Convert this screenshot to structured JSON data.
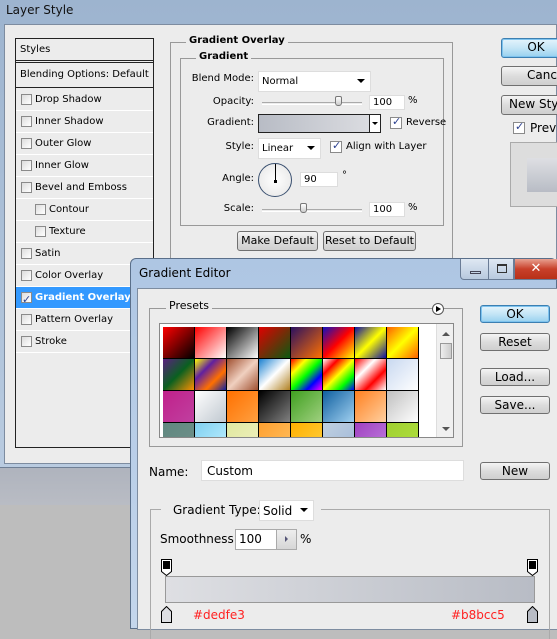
{
  "layer_style": {
    "title": "Layer Style",
    "styles_header": "Styles",
    "blending": "Blending Options: Default",
    "items": [
      {
        "label": "Drop Shadow",
        "checked": false,
        "sub": false
      },
      {
        "label": "Inner Shadow",
        "checked": false,
        "sub": false
      },
      {
        "label": "Outer Glow",
        "checked": false,
        "sub": false
      },
      {
        "label": "Inner Glow",
        "checked": false,
        "sub": false
      },
      {
        "label": "Bevel and Emboss",
        "checked": false,
        "sub": false
      },
      {
        "label": "Contour",
        "checked": false,
        "sub": true
      },
      {
        "label": "Texture",
        "checked": false,
        "sub": true
      },
      {
        "label": "Satin",
        "checked": false,
        "sub": false
      },
      {
        "label": "Color Overlay",
        "checked": false,
        "sub": false
      },
      {
        "label": "Gradient Overlay",
        "checked": true,
        "sub": false,
        "selected": true
      },
      {
        "label": "Pattern Overlay",
        "checked": false,
        "sub": false
      },
      {
        "label": "Stroke",
        "checked": false,
        "sub": false
      }
    ],
    "section": "Gradient Overlay",
    "subsection": "Gradient",
    "blend_mode_label": "Blend Mode:",
    "blend_mode": "Normal",
    "opacity_label": "Opacity:",
    "opacity": "100",
    "opacity_unit": "%",
    "gradient_label": "Gradient:",
    "reverse_label": "Reverse",
    "reverse": true,
    "style_label": "Style:",
    "style": "Linear",
    "align_label": "Align with Layer",
    "align": true,
    "angle_label": "Angle:",
    "angle": "90",
    "angle_unit": "°",
    "scale_label": "Scale:",
    "scale": "100",
    "scale_unit": "%",
    "make_default": "Make Default",
    "reset_default": "Reset to Default",
    "ok": "OK",
    "cancel": "Cancel",
    "new_style": "New Style...",
    "preview": "Preview",
    "preview_checked": true
  },
  "gradient_editor": {
    "title": "Gradient Editor",
    "presets_label": "Presets",
    "swatches": [
      [
        "#ff0000",
        "#000000"
      ],
      [
        "#ff0000",
        "#ffffff"
      ],
      [
        "#000000",
        "#ffffff"
      ],
      [
        "#e00000",
        "#0a5a10"
      ],
      [
        "#2a1060",
        "#ff7000"
      ],
      [
        "#1010c0",
        "#ff0000",
        "#ffff00"
      ],
      [
        "#1010a0",
        "#ffff00",
        "#1010a0"
      ],
      [
        "#ff6000",
        "#ffff00",
        "#ff6000"
      ],
      [
        "#5a2080",
        "#0a6020",
        "#ff9000"
      ],
      [
        "#ffff00",
        "#6020a0",
        "#ff7000",
        "#1020a0"
      ],
      [
        "#a05030",
        "#f0d0c0",
        "#a05030"
      ],
      [
        "#1a80d0",
        "#ffffff",
        "#b08020"
      ],
      [
        "#ff0000",
        "#ffff00",
        "#00ff00",
        "#0000ff",
        "#ff00ff"
      ],
      [
        "#ffffff",
        "#ff0000",
        "#ffff00",
        "#00ff00",
        "#0000ff"
      ],
      [
        "#ff0000",
        "#ffffff",
        "#ff0000",
        "#ffffff"
      ],
      [
        "#c8d8f0",
        "#ffffff"
      ],
      [
        "#c0208a",
        "#c040a0"
      ],
      [
        "#ffffff",
        "#c0c8d0"
      ],
      [
        "#ff7000",
        "#ffa040"
      ],
      [
        "#000000",
        "#808080"
      ],
      [
        "#40a020",
        "#a0d080"
      ],
      [
        "#1060a0",
        "#a0d0f0"
      ],
      [
        "#ff8020",
        "#ffd0a0"
      ],
      [
        "#c0c0c0",
        "#ffffff"
      ],
      [
        "#608880",
        "#70908a"
      ],
      [
        "#80d0f0",
        "#c0f0ff"
      ],
      [
        "#e0e8a0",
        "#f0f0c0"
      ],
      [
        "#ffa030",
        "#ffc060"
      ],
      [
        "#ffb000",
        "#ffd040"
      ],
      [
        "#c0d0e0",
        "#a0b8d8"
      ],
      [
        "#a040c0",
        "#c080e0"
      ],
      [
        "#a0d030",
        "#b0e040"
      ]
    ],
    "ok": "OK",
    "reset": "Reset",
    "load": "Load...",
    "save": "Save...",
    "name_label": "Name:",
    "name_value": "Custom",
    "new": "New",
    "type_label": "Gradient Type:",
    "type_value": "Solid",
    "smooth_label": "Smoothness:",
    "smooth_value": "100",
    "smooth_unit": "%",
    "stop_left": "#dedfe3",
    "stop_right": "#b8bcc5",
    "annotation_color": "#ff2020"
  }
}
